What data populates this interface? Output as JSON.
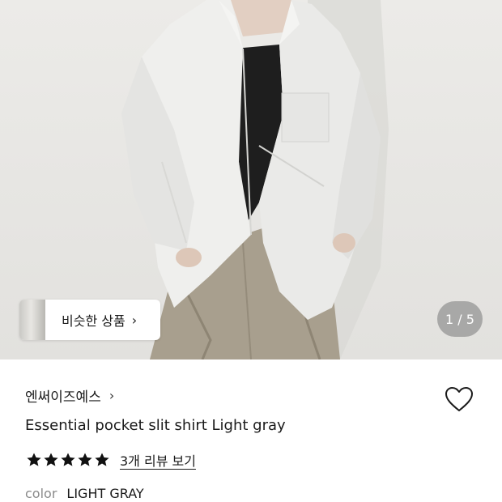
{
  "product_image": {
    "alt_icon": "product-photo",
    "colors": {
      "background": "#e9e8e5",
      "shirt": "#eeeeec",
      "pants": "#a89f8e",
      "inner_top": "#1e1e1e"
    }
  },
  "similar_products": {
    "label": "비슷한 상품",
    "chevron": "›"
  },
  "gallery": {
    "counter": "1 / 5"
  },
  "brand": {
    "name": "엔써이즈예스",
    "chevron": "›"
  },
  "product": {
    "title": "Essential pocket slit shirt Light gray"
  },
  "rating": {
    "stars": 5,
    "max_stars": 5,
    "review_link": "3개 리뷰 보기"
  },
  "option": {
    "label": "color",
    "value": "LIGHT GRAY"
  },
  "icons": {
    "wishlist": "heart-outline-icon",
    "star": "star-filled-icon"
  }
}
